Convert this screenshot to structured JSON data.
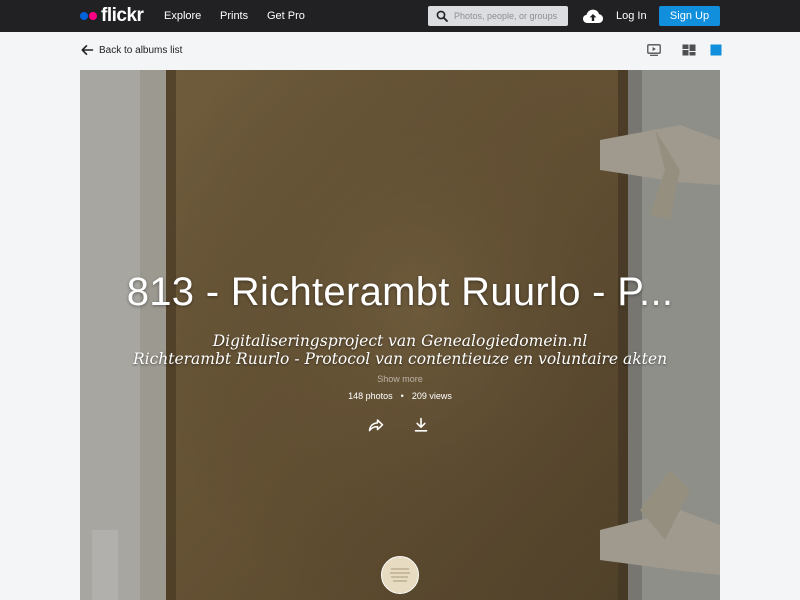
{
  "nav": {
    "logo": "flickr",
    "links": [
      "Explore",
      "Prints",
      "Get Pro"
    ],
    "search_placeholder": "Photos, people, or groups",
    "login": "Log In",
    "signup": "Sign Up",
    "colors": {
      "bar": "#212124",
      "blue_dot": "#0063dc",
      "pink_dot": "#ff0084",
      "signup": "#128fdc"
    }
  },
  "subheader": {
    "back_label": "Back to albums list",
    "view_icons": [
      "slideshow-icon",
      "grid-view-icon",
      "single-view-icon"
    ],
    "active_view_color": "#128fdc"
  },
  "album": {
    "title": "813 - Richterambt Ruurlo - P...",
    "description_lines": [
      "Digitaliseringsproject van Genealogiedomein.nl",
      "Richterambt Ruurlo - Protocol van contentieuze en voluntaire akten"
    ],
    "show_more": "Show more",
    "photos": "148 photos",
    "separator": "•",
    "views": "209 views",
    "actions": [
      "share-icon",
      "download-icon"
    ]
  }
}
